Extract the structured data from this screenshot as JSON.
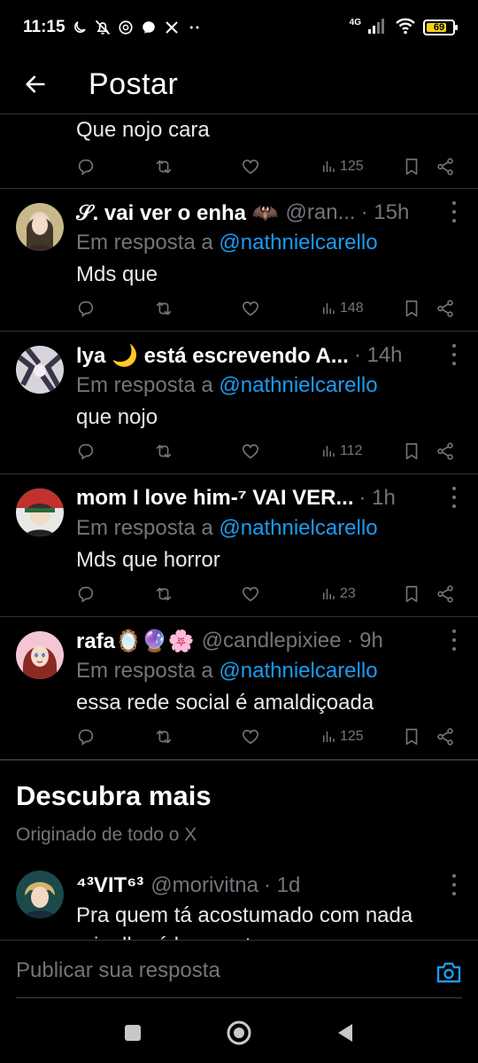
{
  "status_bar": {
    "time": "11:15",
    "network": "4G",
    "battery": "69",
    "icons": [
      "moon-icon",
      "mute-icon",
      "threads-icon",
      "messenger-icon",
      "x-icon",
      "more-dots-icon"
    ]
  },
  "header": {
    "title": "Postar"
  },
  "partial_reply": {
    "text": "Que nojo cara",
    "views": "125"
  },
  "replies": [
    {
      "name": "𝒮. vai ver o enha 🦇",
      "handle": "@ran...",
      "time": "· 15h",
      "reply_label": "Em resposta a",
      "mention": "@nathnielcarello",
      "text": "Mds que",
      "views": "148",
      "avatar_color": "#8a7a5a"
    },
    {
      "name": "lya 🌙 está escrevendo A...",
      "handle": "",
      "time": "· 14h",
      "reply_label": "Em resposta a",
      "mention": "@nathnielcarello",
      "text": "que nojo",
      "views": "112",
      "avatar_color": "#6e6a78"
    },
    {
      "name": "mom I love him-⁷ VAI VER...",
      "handle": "",
      "time": "· 1h",
      "reply_label": "Em resposta a",
      "mention": "@nathnielcarello",
      "text": "Mds que horror",
      "views": "23",
      "avatar_color": "#b33a3a"
    },
    {
      "name": "rafa🪞🔮🌸",
      "handle": "@candlepixiee",
      "time": "· 9h",
      "reply_label": "Em resposta a",
      "mention": "@nathnielcarello",
      "text": "essa rede social é amaldiçoada",
      "views": "125",
      "avatar_color": "#c96a8a"
    }
  ],
  "discover": {
    "title": "Descubra mais",
    "subtitle": "Originado de todo o X",
    "tweet": {
      "name": "⁴³VIT⁶³",
      "handle": "@morivitna",
      "time": "· 1d",
      "text": "Pra quem tá acostumado com nada",
      "text2": "migalha é banquete",
      "avatar_color": "#2f7a6a"
    }
  },
  "composer": {
    "placeholder": "Publicar sua resposta"
  },
  "colors": {
    "background": "#000000",
    "accent": "#1d9bf0",
    "muted": "#71767b",
    "divider": "#2f3336"
  }
}
